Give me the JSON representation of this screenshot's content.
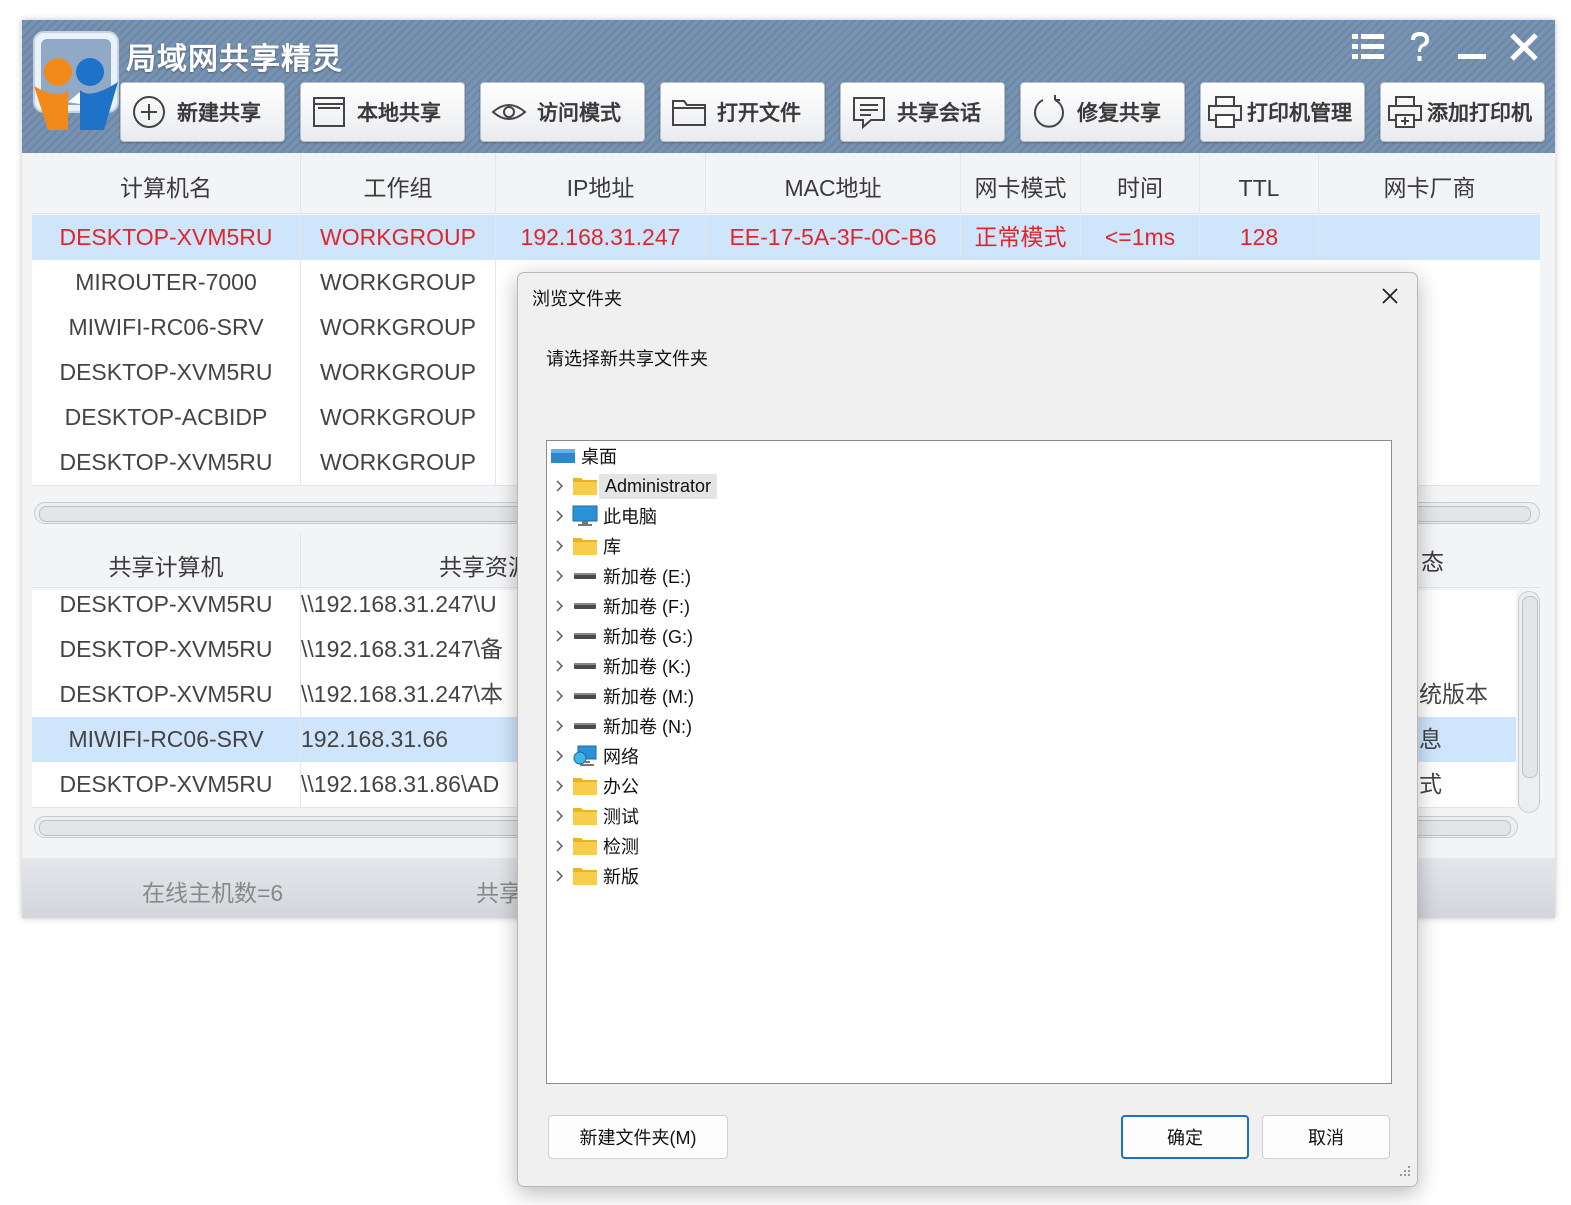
{
  "app": {
    "title": "局域网共享精灵",
    "toolbar": [
      {
        "icon": "plus-circle-icon",
        "label": "新建共享"
      },
      {
        "icon": "window-icon",
        "label": "本地共享"
      },
      {
        "icon": "eye-icon",
        "label": "访问模式"
      },
      {
        "icon": "folder-icon",
        "label": "打开文件"
      },
      {
        "icon": "chat-icon",
        "label": "共享会话"
      },
      {
        "icon": "refresh-icon",
        "label": "修复共享"
      },
      {
        "icon": "printer-icon",
        "label": "打印机管理"
      },
      {
        "icon": "printer-add-icon",
        "label": "添加打印机"
      }
    ],
    "window_controls": [
      "menu-icon",
      "help-icon",
      "minimize-icon",
      "close-icon"
    ]
  },
  "hosts_table": {
    "columns": [
      "计算机名",
      "工作组",
      "IP地址",
      "MAC地址",
      "网卡模式",
      "时间",
      "TTL",
      "网卡厂商"
    ],
    "rows": [
      [
        "DESKTOP-XVM5RU",
        "WORKGROUP",
        "192.168.31.247",
        "EE-17-5A-3F-0C-B6",
        "正常模式",
        "<=1ms",
        "128",
        ""
      ],
      [
        "MIROUTER-7000",
        "WORKGROUP",
        "",
        "",
        "",
        "",
        "",
        ""
      ],
      [
        "MIWIFI-RC06-SRV",
        "WORKGROUP",
        "",
        "",
        "",
        "",
        "",
        ""
      ],
      [
        "DESKTOP-XVM5RU",
        "WORKGROUP",
        "",
        "",
        "",
        "",
        "",
        ""
      ],
      [
        "DESKTOP-ACBIDP",
        "WORKGROUP",
        "",
        "",
        "",
        "",
        "",
        ""
      ],
      [
        "DESKTOP-XVM5RU",
        "WORKGROUP",
        "",
        "",
        "",
        "",
        "",
        ""
      ]
    ],
    "selected_row": 0
  },
  "shares_table": {
    "columns": [
      "共享计算机",
      "共享资源"
    ],
    "partial_header_right": "态",
    "rows": [
      [
        "DESKTOP-XVM5RU",
        "\\\\192.168.31.247\\U"
      ],
      [
        "DESKTOP-XVM5RU",
        "\\\\192.168.31.247\\备"
      ],
      [
        "DESKTOP-XVM5RU",
        "\\\\192.168.31.247\\本"
      ],
      [
        "MIWIFI-RC06-SRV",
        "192.168.31.66"
      ],
      [
        "DESKTOP-XVM5RU",
        "\\\\192.168.31.86\\AD"
      ]
    ],
    "selected_row": 3,
    "right_fragments": [
      "统版本",
      "息",
      "式"
    ]
  },
  "status": {
    "online_hosts": "在线主机数=6",
    "shares_partial": "共享"
  },
  "dialog": {
    "title": "浏览文件夹",
    "prompt": "请选择新共享文件夹",
    "tree": [
      {
        "label": "桌面",
        "icon": "desktop-icon",
        "level": 0,
        "expandable": false
      },
      {
        "label": "Administrator",
        "icon": "folder-icon",
        "level": 1,
        "expandable": true,
        "highlighted": true
      },
      {
        "label": "此电脑",
        "icon": "monitor-icon",
        "level": 1,
        "expandable": true
      },
      {
        "label": "库",
        "icon": "folder-icon",
        "level": 1,
        "expandable": true
      },
      {
        "label": "新加卷 (E:)",
        "icon": "drive-icon",
        "level": 1,
        "expandable": true
      },
      {
        "label": "新加卷 (F:)",
        "icon": "drive-icon",
        "level": 1,
        "expandable": true
      },
      {
        "label": "新加卷 (G:)",
        "icon": "drive-icon",
        "level": 1,
        "expandable": true
      },
      {
        "label": "新加卷 (K:)",
        "icon": "drive-icon",
        "level": 1,
        "expandable": true
      },
      {
        "label": "新加卷 (M:)",
        "icon": "drive-icon",
        "level": 1,
        "expandable": true
      },
      {
        "label": "新加卷 (N:)",
        "icon": "drive-icon",
        "level": 1,
        "expandable": true
      },
      {
        "label": "网络",
        "icon": "network-icon",
        "level": 1,
        "expandable": true
      },
      {
        "label": "办公",
        "icon": "folder-icon",
        "level": 1,
        "expandable": true
      },
      {
        "label": "测试",
        "icon": "folder-icon",
        "level": 1,
        "expandable": true
      },
      {
        "label": "检测",
        "icon": "folder-icon",
        "level": 1,
        "expandable": true
      },
      {
        "label": "新版",
        "icon": "folder-icon",
        "level": 1,
        "expandable": true
      }
    ],
    "buttons": {
      "new_folder": "新建文件夹(M)",
      "ok": "确定",
      "cancel": "取消"
    }
  },
  "colors": {
    "titlebar": "#7390b0",
    "selected_row_bg": "#cfe5fb",
    "selected_row_text": "#e0262b",
    "primary_button_border": "#1f6fc6",
    "folder_yellow": "#f5c542"
  }
}
